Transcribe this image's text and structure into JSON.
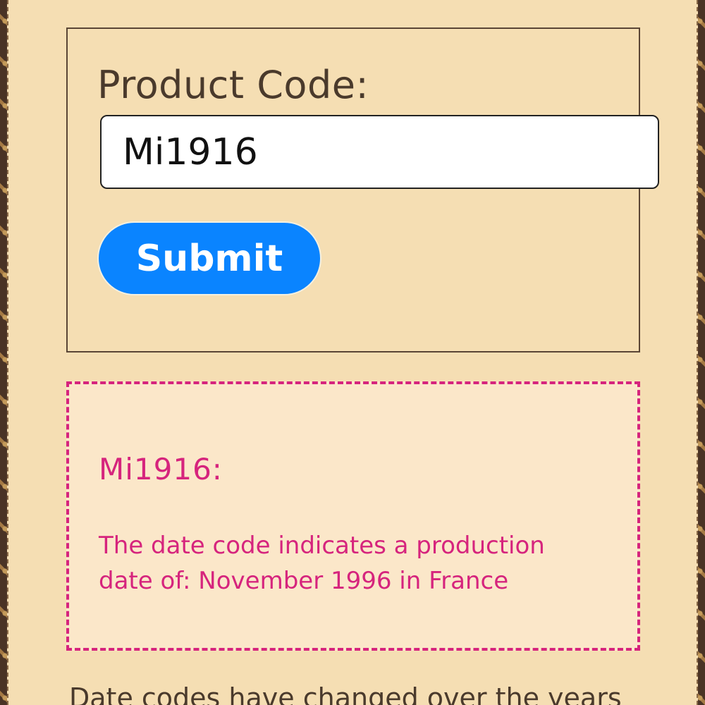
{
  "form": {
    "label": "Product Code:",
    "input_value": "Mi1916",
    "submit_label": "Submit"
  },
  "result": {
    "code_heading": "Mi1916:",
    "message": "The date code indicates a production date of: November 1996 in France"
  },
  "footer": {
    "text": "Date codes have changed over the years"
  },
  "colors": {
    "background": "#f5deb3",
    "accent_blue": "#0a84ff",
    "result_pink": "#d6247d",
    "result_bg": "#fbe7c9"
  }
}
